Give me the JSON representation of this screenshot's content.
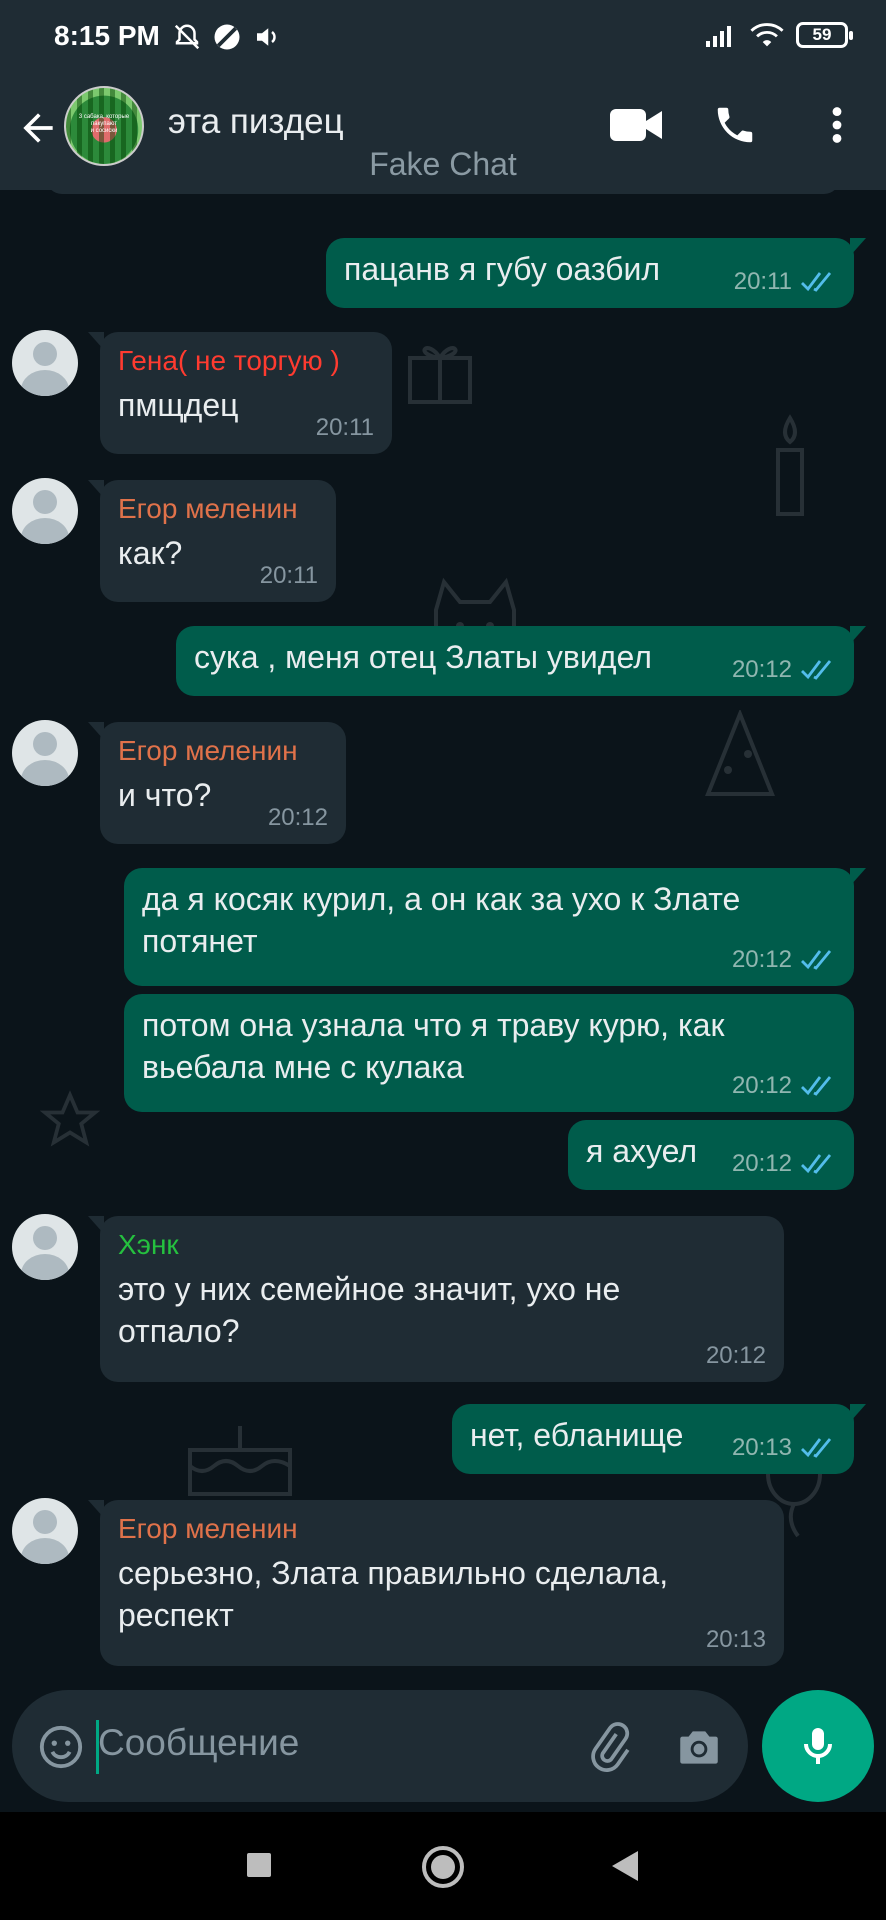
{
  "status_bar": {
    "time": "8:15 PM",
    "battery": "59"
  },
  "header": {
    "title": "эта пиздец",
    "avatar_text": "3 сабака, которые\nпакупают\nи сосиски"
  },
  "watermark": "Fake Chat",
  "messages": [
    {
      "dir": "out",
      "text": "пацанв я губу оазбил",
      "time": "20:11"
    },
    {
      "dir": "in",
      "sender": "Гена( не торгую )",
      "sender_color": "#ff3b30",
      "text": "пмщдец",
      "time": "20:11"
    },
    {
      "dir": "in",
      "sender": "Егор меленин",
      "sender_color": "#e0724a",
      "text": "как?",
      "time": "20:11"
    },
    {
      "dir": "out",
      "text": "сука , меня отец Златы увидел",
      "time": "20:12"
    },
    {
      "dir": "in",
      "sender": "Егор меленин",
      "sender_color": "#e0724a",
      "text": "и что?",
      "time": "20:12"
    },
    {
      "dir": "out",
      "text": "да я косяк курил, а он как за ухо к Злате\nпотянет",
      "time": "20:12"
    },
    {
      "dir": "out",
      "text": "потом она узнала что я траву курю, как\nвьебала мне с кулака",
      "time": "20:12"
    },
    {
      "dir": "out",
      "text": "я ахуел",
      "time": "20:12"
    },
    {
      "dir": "in",
      "sender": "Хэнк",
      "sender_color": "#25c03f",
      "text": "это у них семейное значит, ухо не\nотпало?",
      "time": "20:12"
    },
    {
      "dir": "out",
      "text": "нет, ебланище",
      "time": "20:13"
    },
    {
      "dir": "in",
      "sender": "Егор меленин",
      "sender_color": "#e0724a",
      "text": "серьезно, Злата правильно сделала,\nреспект",
      "time": "20:13"
    }
  ],
  "input": {
    "placeholder": "Сообщение"
  },
  "colors": {
    "outgoing": "#005c4b",
    "incoming": "#1f2c34",
    "accent": "#00a884",
    "read_ticks": "#53bdeb"
  },
  "icons": [
    "back-arrow-icon",
    "video-call-icon",
    "voice-call-icon",
    "more-icon",
    "emoji-icon",
    "attach-icon",
    "camera-icon",
    "mic-icon",
    "nav-square-icon",
    "nav-circle-icon",
    "nav-back-icon"
  ]
}
